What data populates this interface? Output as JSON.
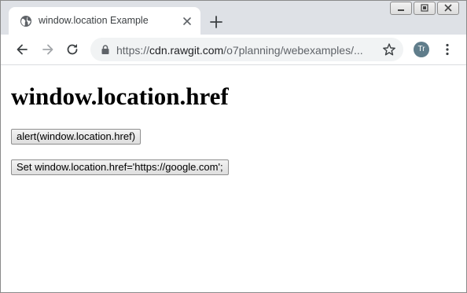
{
  "browser": {
    "tab": {
      "title": "window.location Example"
    },
    "address_bar": {
      "url_prefix": "https://",
      "url_domain": "cdn.rawgit.com",
      "url_path": "/o7planning/webexamples/..."
    },
    "profile": {
      "initials": "Tr"
    },
    "icons": {
      "favicon": "globe-icon",
      "close": "close-icon",
      "new_tab": "plus-icon",
      "back": "back-arrow-icon",
      "forward": "forward-arrow-icon",
      "reload": "reload-icon",
      "lock": "lock-icon",
      "bookmark": "star-icon",
      "menu": "more-vert-icon"
    },
    "colors": {
      "tabstrip": "#dee1e6",
      "omnibox": "#f1f3f4",
      "avatar": "#607d8b"
    }
  },
  "page": {
    "heading": "window.location.href",
    "buttons": [
      {
        "label": "alert(window.location.href)"
      },
      {
        "label": "Set window.location.href='https://google.com';"
      }
    ]
  }
}
